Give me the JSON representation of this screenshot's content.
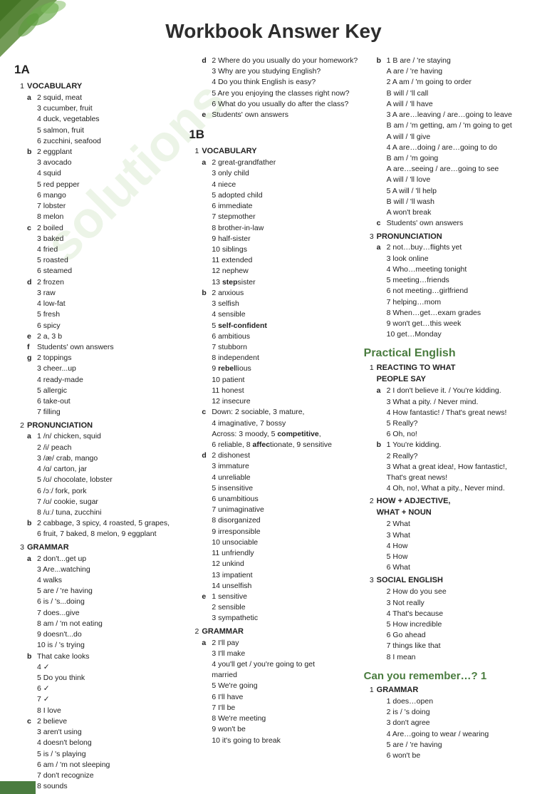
{
  "page": {
    "title": "Workbook Answer Key"
  },
  "col1": {
    "section1A": {
      "label": "1A",
      "vocab": {
        "title": "VOCABULARY",
        "number": "1",
        "groups": [
          {
            "letter": "a",
            "items": [
              "2 squid, meat",
              "3 cucumber, fruit",
              "4 duck, vegetables",
              "5 salmon, fruit",
              "6 zucchini, seafood"
            ]
          },
          {
            "letter": "b",
            "items": [
              "2 eggplant",
              "3 avocado",
              "4 squid",
              "5 red pepper",
              "6 mango",
              "7 lobster",
              "8 melon"
            ]
          },
          {
            "letter": "c",
            "items": [
              "2 boiled",
              "3 baked",
              "4 fried",
              "5 roasted",
              "6 steamed"
            ]
          },
          {
            "letter": "d",
            "items": [
              "2 frozen",
              "3 raw",
              "4 low-fat",
              "5 fresh",
              "6 spicy"
            ]
          },
          {
            "letter": "e",
            "items": [
              "2 a, 3 b"
            ]
          },
          {
            "letter": "f",
            "items": [
              "Students' own answers"
            ]
          },
          {
            "letter": "g",
            "items": [
              "2 toppings",
              "3 cheer...up",
              "4 ready-made",
              "5 allergic",
              "6 take-out",
              "7 filling"
            ]
          }
        ]
      },
      "pronunciation": {
        "title": "PRONUNCIATION",
        "number": "2",
        "groups": [
          {
            "letter": "a",
            "items": [
              "1 /n/ chicken, squid",
              "2 /i/ peach",
              "3 /æ/ crab, mango",
              "4 /ɑ/ carton, jar",
              "5 /ʊ/ chocolate, lobster",
              "6 /ɔː/ fork, pork",
              "7 /ʊ/ cookie, sugar",
              "8 /uː/ tuna, zucchini"
            ]
          },
          {
            "letter": "b",
            "items": [
              "2 cabbage, 3 spicy, 4 roasted, 5 grapes, 6 fruit, 7 baked, 8 melon, 9 eggplant"
            ]
          }
        ]
      },
      "grammar": {
        "title": "GRAMMAR",
        "number": "3",
        "groups": [
          {
            "letter": "a",
            "items": [
              "2 don't...get up",
              "3 Are...watching",
              "4 walks",
              "5 are / 're having",
              "6 is / 's...doing",
              "7 does...give",
              "8 am / 'm not eating",
              "9 doesn't...do",
              "10 is / 's trying",
              "That cake looks",
              "4 ✓",
              "5 Do you think",
              "6 ✓",
              "7 ✓",
              "8 I love"
            ]
          },
          {
            "letter": "c",
            "items": [
              "2 believe",
              "3 aren't using",
              "4 doesn't belong",
              "5 is / 's playing",
              "6 am / 'm not sleeping",
              "7 don't recognize",
              "8 sounds"
            ]
          }
        ]
      }
    }
  },
  "col2": {
    "section1A_d": {
      "items_d": [
        "2 Where do you usually do your homework?",
        "3 Why are you studying English?",
        "4 Do you think English is easy?",
        "5 Are you enjoying the classes right now?",
        "6 What do you usually do after the class?"
      ],
      "item_e": "Students' own answers"
    },
    "section1B": {
      "label": "1B",
      "vocab": {
        "title": "VOCABULARY",
        "number": "1",
        "groups": [
          {
            "letter": "a",
            "items": [
              "2 great-grandfather",
              "3 only child",
              "4 niece",
              "5 adopted child",
              "6 immediate",
              "7 stepmother",
              "8 brother-in-law",
              "9 half-sister",
              "10 siblings",
              "11 extended",
              "12 nephew",
              "13 stepsister"
            ]
          },
          {
            "letter": "b",
            "items": [
              "2 anxious",
              "3 selfish",
              "4 sensible",
              "5 self-confident",
              "6 ambitious",
              "7 stubborn",
              "8 independent",
              "9 rebellious",
              "10 patient",
              "11 honest",
              "12 insecure"
            ]
          },
          {
            "letter": "c",
            "items": [
              "Down: 2 sociable, 3 mature, 4 imaginative, 7 bossy",
              "Across: 3 moody, 5 competitive, 6 reliable, 8 affectionate, 9 sensitive"
            ]
          },
          {
            "letter": "d",
            "items": [
              "2 dishonest",
              "3 immature",
              "4 unreliable",
              "5 insensitive",
              "6 unambitious",
              "7 unimaginative",
              "8 disorganized",
              "9 irresponsible",
              "10 unsociable",
              "11 unfriendly",
              "12 unkind",
              "13 impatient",
              "14 unselfish"
            ]
          },
          {
            "letter": "e",
            "items": [
              "1 sensitive",
              "2 sensible",
              "3 sympathetic"
            ]
          }
        ]
      },
      "grammar": {
        "title": "GRAMMAR",
        "number": "2",
        "groups": [
          {
            "letter": "a",
            "items": [
              "2 I'll pay",
              "3 I'll make",
              "4 you'll get / you're going to get married",
              "5 We're going",
              "6 I'll have",
              "7 I'll be",
              "8 We're meeting",
              "9 won't be",
              "10 it's going to break"
            ]
          }
        ]
      }
    }
  },
  "col3": {
    "section1B_b": {
      "title": "b",
      "items": [
        "1 B are / 're staying",
        "A are / 're having",
        "2 A am / 'm going to order",
        "B will / 'll call",
        "A will / 'll have",
        "3 A are…leaving / are…going to leave",
        "B am / 'm getting, am / 'm going to get",
        "A will / 'll give",
        "4 A are…doing / are…going to do",
        "B am / 'm going",
        "A are…seeing / are…going to see",
        "A will / 'll love",
        "5 A will / 'll help",
        "B will / 'll wash",
        "A won't break"
      ],
      "item_c": "c Students' own answers"
    },
    "pronunciation": {
      "title": "PRONUNCIATION",
      "number": "3",
      "groups": [
        {
          "letter": "a",
          "items": [
            "2 not…buy…flights yet",
            "3 look online",
            "4 Who…meeting tonight",
            "5 meeting…friends",
            "6 not meeting…girlfriend",
            "7 helping…mom",
            "8 When…get…exam grades",
            "9 won't get…this week",
            "10 get…Monday"
          ]
        }
      ]
    },
    "practical_english": {
      "heading": "Practical English",
      "reacting": {
        "number": "1",
        "title": "REACTING TO WHAT PEOPLE SAY",
        "groups": [
          {
            "letter": "a",
            "items": [
              "2 I don't believe it. / You're kidding.",
              "3 What a pity. / Never mind.",
              "4 How fantastic! / That's great news!",
              "5 Really?",
              "6 Oh, no!"
            ]
          },
          {
            "letter": "b",
            "items": [
              "1 You're kidding.",
              "2 Really?",
              "3 What a great idea!, How fantastic!, That's great news!",
              "4 Oh, no!, What a pity., Never mind."
            ]
          }
        ]
      },
      "how_adjective": {
        "number": "2",
        "title": "HOW + ADJECTIVE, WHAT + NOUN",
        "items": [
          "2 What",
          "3 What",
          "4 How",
          "5 How",
          "6 What"
        ]
      },
      "social_english": {
        "number": "3",
        "title": "SOCIAL ENGLISH",
        "items": [
          "2 How do you see",
          "3 Not really",
          "4 That's because",
          "5 How incredible",
          "6 Go ahead",
          "7 things like that",
          "8 I mean"
        ]
      }
    },
    "can_you": {
      "heading": "Can you remember…? 1",
      "grammar": {
        "number": "1",
        "title": "GRAMMAR",
        "items": [
          "1 does…open",
          "2 is / 's doing",
          "3 don't agree",
          "4 Are…going to wear / wearing",
          "5 are / 're having",
          "6 won't be"
        ]
      }
    }
  }
}
